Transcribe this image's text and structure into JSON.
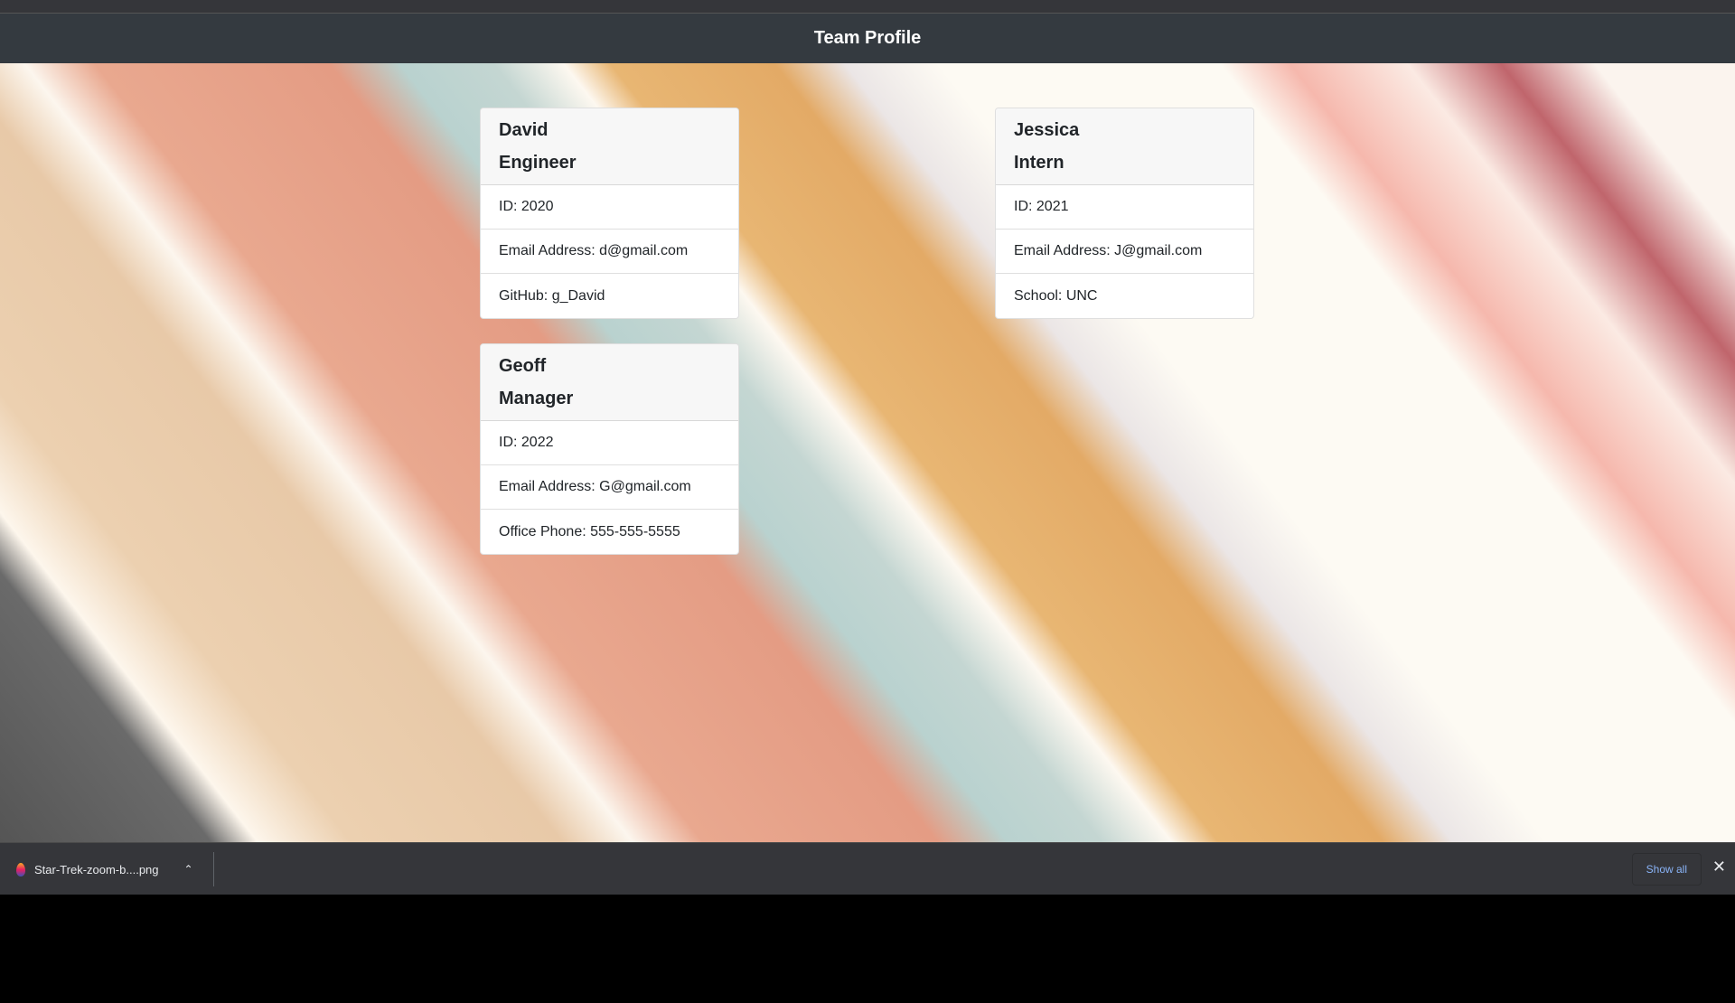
{
  "header": {
    "title": "Team Profile"
  },
  "cards": [
    {
      "name": "David",
      "role": "Engineer",
      "rows": [
        "ID: 2020",
        "Email Address: d@gmail.com",
        "GitHub: g_David"
      ]
    },
    {
      "name": "Geoff",
      "role": "Manager",
      "rows": [
        "ID: 2022",
        "Email Address: G@gmail.com",
        "Office Phone: 555-555-5555"
      ]
    },
    {
      "name": "Jessica",
      "role": "Intern",
      "rows": [
        "ID: 2021",
        "Email Address: J@gmail.com",
        "School: UNC"
      ]
    }
  ],
  "download_bar": {
    "file": "Star-Trek-zoom-b....png",
    "show_all": "Show all"
  },
  "colors": {
    "navbar": "#343a40",
    "link": "#8ab4f8"
  }
}
